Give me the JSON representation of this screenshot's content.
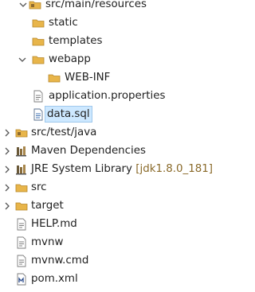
{
  "tree": {
    "items": [
      {
        "label": "src/main/resources",
        "decoration": "",
        "icon": "package-folder-icon",
        "expanded": true
      },
      {
        "label": "static",
        "decoration": "",
        "icon": "folder-icon"
      },
      {
        "label": "templates",
        "decoration": "",
        "icon": "folder-icon"
      },
      {
        "label": "webapp",
        "decoration": "",
        "icon": "folder-icon",
        "expanded": true
      },
      {
        "label": "WEB-INF",
        "decoration": "",
        "icon": "folder-icon"
      },
      {
        "label": "application.properties",
        "decoration": "",
        "icon": "properties-file-icon"
      },
      {
        "label": "data.sql",
        "decoration": "",
        "icon": "sql-file-icon",
        "selected": true
      },
      {
        "label": "src/test/java",
        "decoration": "",
        "icon": "source-folder-icon",
        "expanded": false
      },
      {
        "label": "Maven Dependencies",
        "decoration": "",
        "icon": "library-icon",
        "expanded": false
      },
      {
        "label": "JRE System Library ",
        "decoration": "[jdk1.8.0_181]",
        "icon": "library-icon",
        "expanded": false
      },
      {
        "label": "src",
        "decoration": "",
        "icon": "folder-icon",
        "expanded": false
      },
      {
        "label": "target",
        "decoration": "",
        "icon": "folder-icon",
        "expanded": false
      },
      {
        "label": "HELP.md",
        "decoration": "",
        "icon": "text-file-icon"
      },
      {
        "label": "mvnw",
        "decoration": "",
        "icon": "text-file-icon"
      },
      {
        "label": "mvnw.cmd",
        "decoration": "",
        "icon": "text-file-icon"
      },
      {
        "label": "pom.xml",
        "decoration": "",
        "icon": "maven-pom-icon"
      }
    ]
  },
  "colors": {
    "folder": "#e8b54a",
    "selection": "#cde8ff",
    "decoration": "#8a6a2a"
  }
}
